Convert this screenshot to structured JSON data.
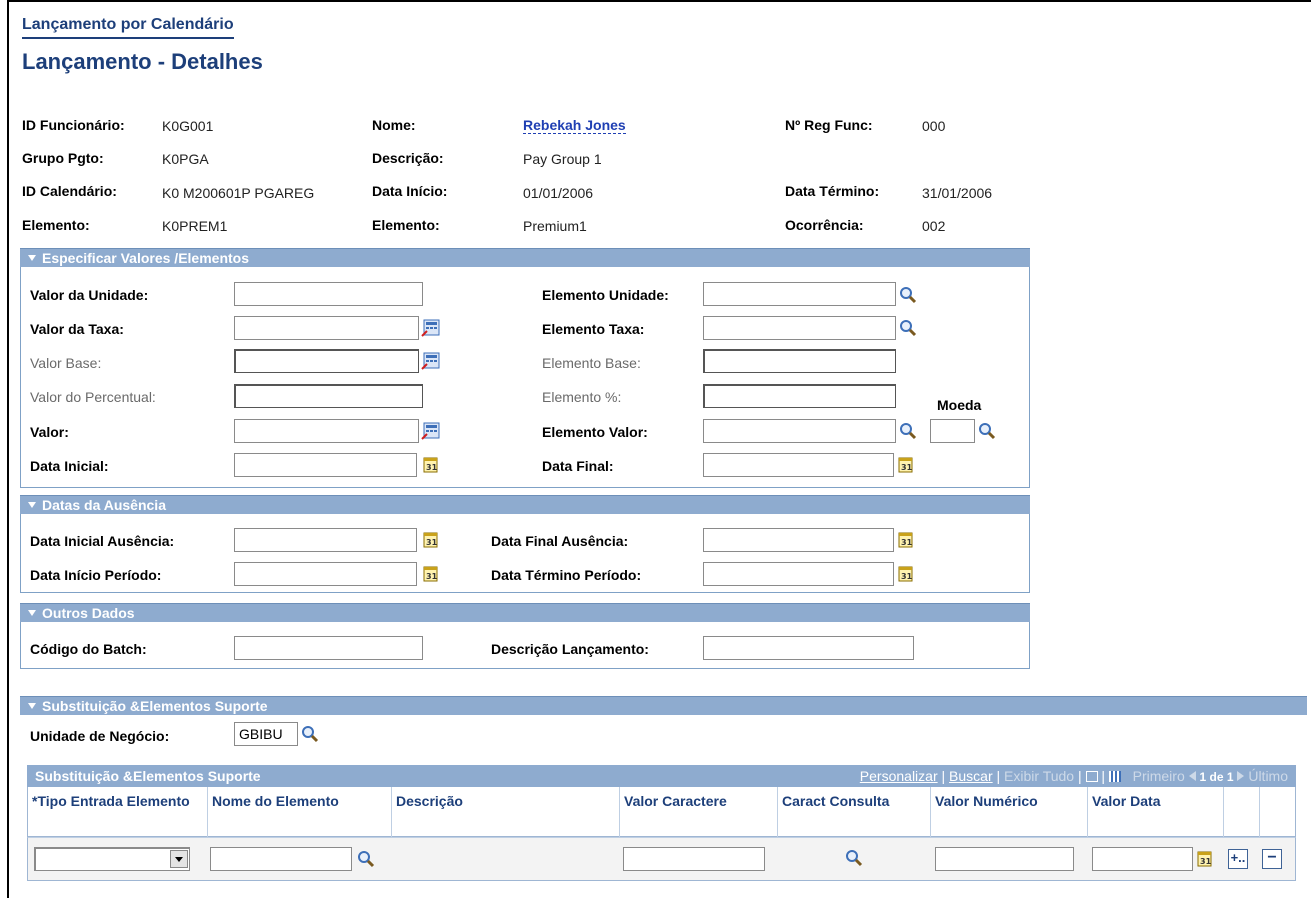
{
  "breadcrumb": "Lançamento por Calendário",
  "page_title": "Lançamento - Detalhes",
  "header": {
    "id_funcionario_label": "ID Funcionário:",
    "id_funcionario": "K0G001",
    "nome_label": "Nome:",
    "nome": "Rebekah Jones",
    "reg_func_label": "Nº Reg Func:",
    "reg_func": "000",
    "grupo_pgto_label": "Grupo Pgto:",
    "grupo_pgto": "K0PGA",
    "descricao_label": "Descrição:",
    "descricao": "Pay Group 1",
    "id_calendario_label": "ID Calendário:",
    "id_calendario": "K0 M200601P PGAREG",
    "data_inicio_label": "Data Início:",
    "data_inicio": "01/01/2006",
    "data_termino_label": "Data Término:",
    "data_termino": "31/01/2006",
    "elemento_label": "Elemento:",
    "elemento": "K0PREM1",
    "elemento2_label": "Elemento:",
    "elemento2": "Premium1",
    "ocorrencia_label": "Ocorrência:",
    "ocorrencia": "002"
  },
  "sec_valores": {
    "title": "Especificar Valores /Elementos",
    "valor_unidade": "Valor da Unidade:",
    "valor_taxa": "Valor da Taxa:",
    "valor_base": "Valor Base:",
    "valor_percentual": "Valor do Percentual:",
    "valor": "Valor:",
    "data_inicial": "Data Inicial:",
    "elemento_unidade": "Elemento Unidade:",
    "elemento_taxa": "Elemento Taxa:",
    "elemento_base": "Elemento Base:",
    "elemento_pct": "Elemento %:",
    "elemento_valor": "Elemento Valor:",
    "data_final": "Data Final:",
    "moeda": "Moeda"
  },
  "sec_ausencia": {
    "title": "Datas da Ausência",
    "data_inicial_ausencia": "Data Inicial Ausência:",
    "data_inicio_periodo": "Data Início Período:",
    "data_final_ausencia": "Data Final Ausência:",
    "data_termino_periodo": "Data Término Período:"
  },
  "sec_outros": {
    "title": "Outros Dados",
    "codigo_batch": "Código do Batch:",
    "descricao_lancamento": "Descrição Lançamento:"
  },
  "sec_subst": {
    "title": "Substituição &Elementos Suporte",
    "unidade_negocio_label": "Unidade de Negócio:",
    "unidade_negocio": "GBIBU"
  },
  "grid": {
    "title": "Substituição &Elementos Suporte",
    "personalizar": "Personalizar",
    "buscar": "Buscar",
    "exibir_tudo": "Exibir Tudo",
    "primeiro": "Primeiro",
    "paging": "1 de 1",
    "ultimo": "Último",
    "columns": [
      "*Tipo Entrada Elemento",
      "Nome do Elemento",
      "Descrição",
      "Valor Caractere",
      "Caract Consulta",
      "Valor Numérico",
      "Valor Data"
    ],
    "add_label": "+..",
    "remove_label": "−"
  },
  "icons": {
    "lookup": "magnifier-icon",
    "calendar": "calendar-icon",
    "calculator": "calculator-icon"
  }
}
